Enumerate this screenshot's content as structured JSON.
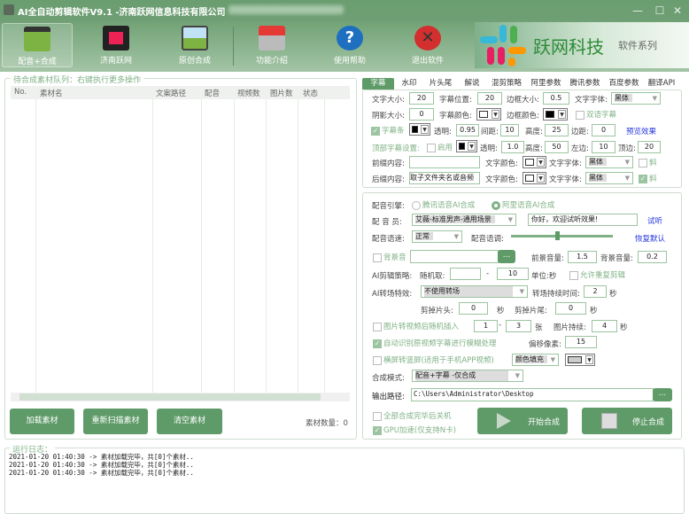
{
  "window": {
    "title": "AI全自动剪辑软件V9.1 -济南跃网信息科技有限公司",
    "minimize": "—",
    "maximize": "☐",
    "close": "✕"
  },
  "toolbar": [
    {
      "label": "配音+合成",
      "icon": "clapperboard-icon",
      "active": true
    },
    {
      "label": "济南跃网",
      "icon": "film-reel-icon"
    },
    {
      "label": "原创合成",
      "icon": "picture-icon"
    },
    {
      "label": "功能介绍",
      "icon": "home-icon"
    },
    {
      "label": "使用帮助",
      "icon": "help-icon"
    },
    {
      "label": "退出软件",
      "icon": "exit-icon"
    }
  ],
  "logo": {
    "name": "跃网科技",
    "suffix": "软件系列",
    "colors": [
      "#36b8d8",
      "#4caf50",
      "#e91e63",
      "#ff9800"
    ]
  },
  "queue": {
    "legend": "待合成素材队列：右键执行更多操作",
    "columns": [
      "No.",
      "素材名",
      "文案路径",
      "配音",
      "视频数",
      "图片数",
      "状态"
    ],
    "buttons": [
      "加载素材",
      "重新扫描素材",
      "清空素材"
    ],
    "count_label": "素材数量：0"
  },
  "log": {
    "legend": "运行日志：",
    "lines": [
      "2021-01-20 01:40:30 -> 素材加载完毕，共[0]个素材..",
      "2021-01-20 01:40:30 -> 素材加载完毕，共[0]个素材..",
      "2021-01-20 01:40:30 -> 素材加载完毕，共[0]个素材.."
    ]
  },
  "tabs": [
    "字幕",
    "水印",
    "片头尾",
    "解说",
    "混剪策略",
    "阿里参数",
    "腾讯参数",
    "百度参数",
    "翻译API"
  ],
  "subtitle": {
    "font_size_label": "文字大小:",
    "font_size": "20",
    "pos_label": "字幕位置:",
    "pos": "20",
    "border_size_label": "边框大小:",
    "border_size": "0.5",
    "font_label": "文字字体:",
    "font": "黑体",
    "shadow_label": "阴影大小:",
    "shadow": "0",
    "color_label": "字幕颜色:",
    "border_color_label": "边框颜色:",
    "bilingual": "双语字幕",
    "bar": "字幕条",
    "alpha_label": "透明:",
    "alpha": "0.95",
    "spacing_label": "间距:",
    "spacing": "10",
    "height_label": "高度:",
    "height": "25",
    "margin_label": "边距:",
    "margin": "0",
    "preview": "预览效果",
    "top_label": "顶部字幕设置:",
    "top_enable": "启用",
    "top_alpha_label": "透明:",
    "top_alpha": "1.0",
    "top_height_label": "高度:",
    "top_height": "50",
    "left_label": "左边:",
    "left": "10",
    "topm_label": "顶边:",
    "topm": "20",
    "prefix_label": "前缀内容:",
    "prefix": "",
    "text_color_label": "文字颜色:",
    "text_font_label": "文字字体:",
    "prefix_font": "黑体",
    "italic": "斜",
    "suffix_label": "后缀内容:",
    "suffix": "取子文件夹名或音频",
    "suffix_font": "黑体"
  },
  "voice": {
    "engine_label": "配音引擎:",
    "engine_options": [
      "腾讯语音AI合成",
      "阿里语音AI合成"
    ],
    "engine_selected": "阿里语音AI合成",
    "voice_label": "配 音 员:",
    "voice": "艾薇-标准男声-通用场景",
    "test_text": "你好，欢迎试听效果!",
    "listen": "试听",
    "speed_label": "配音语速:",
    "speed": "正常",
    "pitch_label": "配音语调:",
    "pitch_level": 0.45,
    "reset": "恢复默认",
    "bgm": "背景音",
    "bgm_path": "",
    "browse": "...",
    "fg_vol_label": "前景音量:",
    "fg_vol": "1.5",
    "bg_vol_label": "背景音量:",
    "bg_vol": "0.2",
    "strategy_label": "AI剪辑策略:",
    "random_label": "随机取:",
    "random_min": "",
    "dash": "-",
    "random_max": "10",
    "unit": "单位:秒",
    "allow_repeat": "允许重复剪辑",
    "transition_label": "AI转场特效:",
    "transition": "不使用转场",
    "transition_dur_label": "转场持续时间:",
    "transition_dur": "2",
    "sec": "秒",
    "cut_head_label": "剪掉片头:",
    "cut_head": "0",
    "cut_tail_label": "剪掉片尾:",
    "cut_tail": "0",
    "img_insert": "图片转视频后随机插入",
    "img_min": "1",
    "img_max": "3",
    "img_unit": "张",
    "img_dur_label": "图片持续:",
    "img_dur": "4",
    "blur_sub": "自动识别原视频字幕进行模糊处理",
    "offset_label": "偏移像素:",
    "offset": "15",
    "vertical": "横屏转竖屏(适用于手机APP视频)",
    "fill": "颜色填充",
    "mode_label": "合成模式:",
    "mode": "配音+字幕 -仅合成",
    "output_label": "输出路径:",
    "output": "C:\\Users\\Administrator\\Desktop",
    "shutdown": "全部合成完毕后关机",
    "gpu": "GPU加速(仅支持N卡)",
    "start": "开始合成",
    "stop": "停止合成"
  }
}
